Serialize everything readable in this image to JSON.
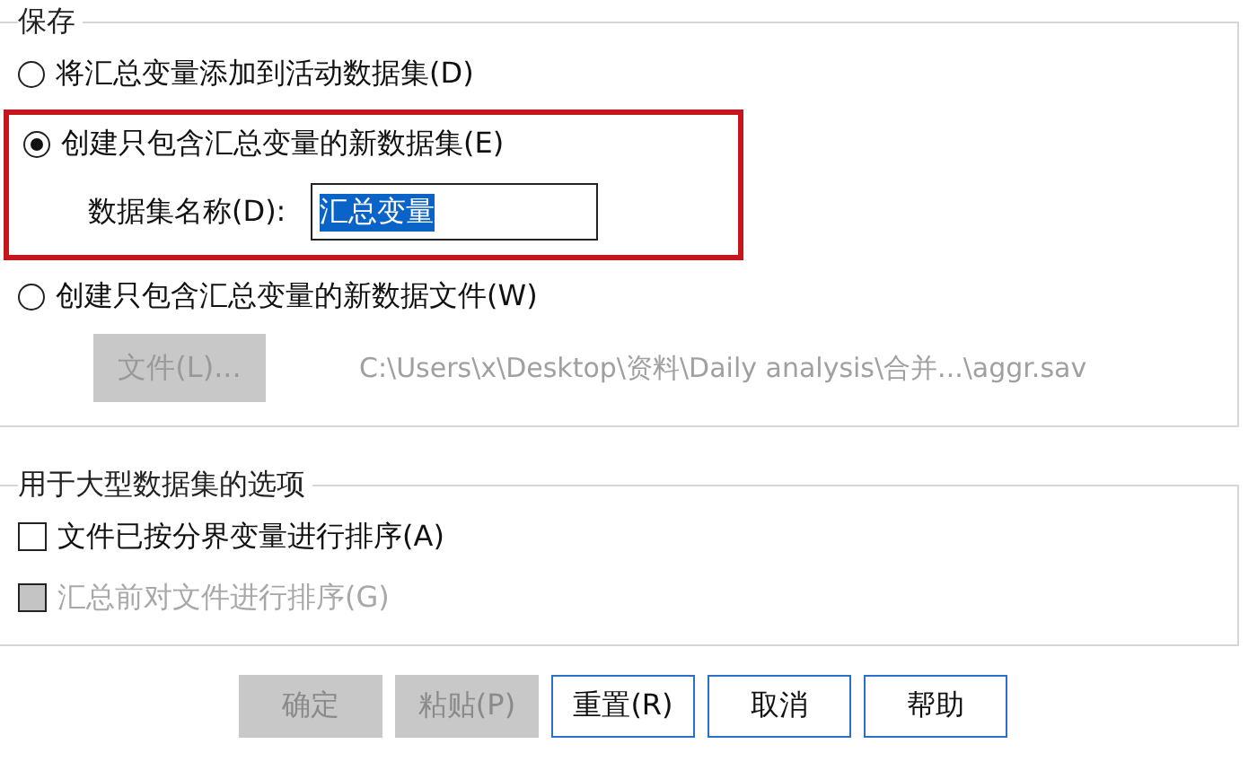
{
  "save_group": {
    "title": "保存",
    "options": [
      {
        "label": "将汇总变量添加到活动数据集(D)",
        "selected": false
      },
      {
        "label": "创建只包含汇总变量的新数据集(E)",
        "selected": true
      },
      {
        "label": "创建只包含汇总变量的新数据文件(W)",
        "selected": false
      }
    ],
    "dataset_name": {
      "label": "数据集名称(D):",
      "value": "汇总变量"
    },
    "file_button": {
      "label": "文件(L)...",
      "disabled": true
    },
    "file_path": "C:\\Users\\x\\Desktop\\资料\\Daily analysis\\合并...\\aggr.sav"
  },
  "large_group": {
    "title": "用于大型数据集的选项",
    "checks": [
      {
        "label": "文件已按分界变量进行排序(A)",
        "checked": false,
        "disabled": false
      },
      {
        "label": "汇总前对文件进行排序(G)",
        "checked": false,
        "disabled": true
      }
    ]
  },
  "buttons": [
    {
      "label": "确定",
      "disabled": true
    },
    {
      "label": "粘贴(P)",
      "disabled": true
    },
    {
      "label": "重置(R)",
      "disabled": false
    },
    {
      "label": "取消",
      "disabled": false
    },
    {
      "label": "帮助",
      "disabled": false
    }
  ]
}
